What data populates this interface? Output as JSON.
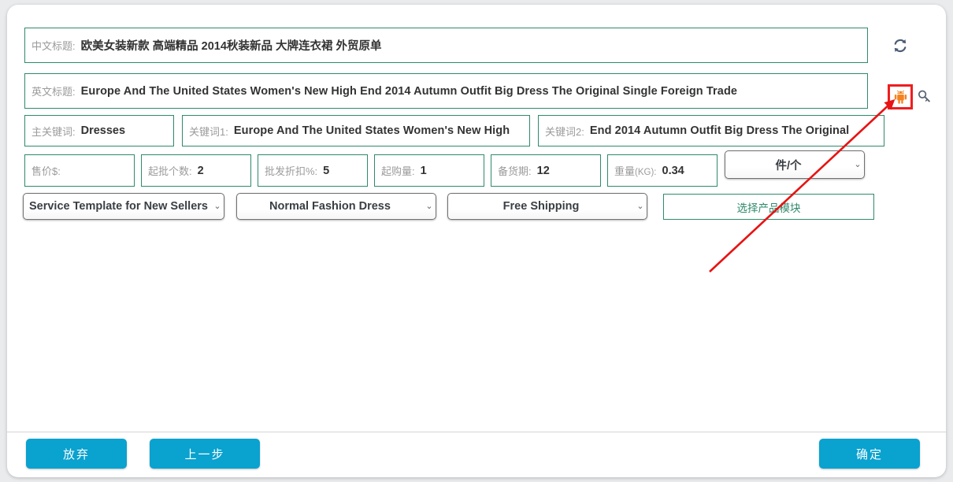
{
  "window": {
    "title_cn_label": "中文标题:",
    "title_cn_value": "欧美女装新款 高端精品 2014秋装新品 大牌连衣裙 外贸原单",
    "title_en_label": "英文标题:",
    "title_en_value": "Europe And The United States Women's New High End 2014 Autumn Outfit Big Dress The Original Single Foreign Trade"
  },
  "keywords": [
    {
      "label": "主关键词:",
      "value": "Dresses"
    },
    {
      "label": "关键词1:",
      "value": "Europe And The United States Women's New High"
    },
    {
      "label": "关键词2:",
      "value": "End 2014 Autumn Outfit Big Dress The Original"
    }
  ],
  "numbers": [
    {
      "label": "售价$:",
      "value": ""
    },
    {
      "label": "起批个数:",
      "value": "2"
    },
    {
      "label": "批发折扣%:",
      "value": "5"
    },
    {
      "label": "起购量:",
      "value": "1"
    },
    {
      "label": "备货期:",
      "value": "12"
    },
    {
      "label": "重量",
      "unit": "(KG):",
      "value": "0.34"
    }
  ],
  "unit_select": {
    "value": "件/个",
    "caret": "⌄"
  },
  "selects": [
    {
      "name": "service-template",
      "value": "Service Template for New Sellers",
      "caret": "⌄"
    },
    {
      "name": "product-group",
      "value": "Normal Fashion Dress",
      "caret": "⌄"
    },
    {
      "name": "shipping-template",
      "value": "Free Shipping",
      "caret": "⌄"
    }
  ],
  "product_module_button": {
    "label": "选择产品模块"
  },
  "icons": {
    "refresh": "refresh-sync-icon",
    "android": "android-robot-icon",
    "search": "magnifier-search-icon"
  },
  "footer": {
    "cancel": "放弃",
    "previous": "上一步",
    "confirm": "确定"
  },
  "colors": {
    "field_border": "#2f8a6b",
    "accent_button": "#0aa2cf",
    "highlight": "#ef1d1d",
    "android_orange": "#f58220",
    "page_background": "#e9ebed"
  }
}
